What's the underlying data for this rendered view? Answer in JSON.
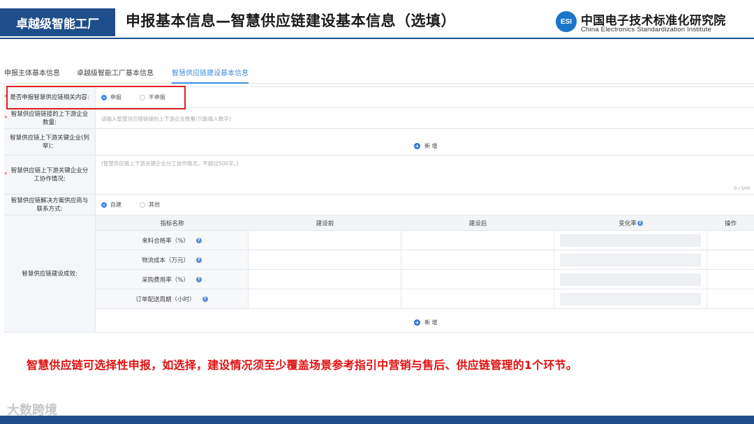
{
  "header": {
    "badge": "卓越级智能工厂",
    "title": "申报基本信息—智慧供应链建设基本信息（选填）",
    "logo_mark": "ESI",
    "logo_cn": "中国电子技术标准化研究院",
    "logo_en": "China Electronics Standardization Institute"
  },
  "tabs": [
    {
      "label": "申报主体基本信息"
    },
    {
      "label": "卓越级智能工厂基本信息"
    },
    {
      "label": "智慧供应链建设基本信息"
    }
  ],
  "form": {
    "declare": {
      "label": "是否申报智慧供应链相关内容:",
      "options": [
        "申报",
        "不申报"
      ]
    },
    "upstream_count": {
      "label": "智慧供应链链接的上下游企业数量:",
      "placeholder": "请输入智慧供应链链接的上下游企业数量(只能输入数字)"
    },
    "key_enterprises": {
      "label": "智慧供应链上下游关键企业(列举)：",
      "add_label": "新 增"
    },
    "division": {
      "label": "智慧供应链上下游关键企业分工协作情况:",
      "placeholder": "(智慧供应链上下游关键企业分工协作情况，不超过500字。)",
      "counter": "0 / 500"
    },
    "contact": {
      "label": "智慧供应链解决方案供应商与联系方式:",
      "options": [
        "自建",
        "其他"
      ]
    },
    "results": {
      "label": "智慧供应链建设成效:",
      "columns": [
        "指标名称",
        "建设前",
        "建设后",
        "变化率",
        "操作"
      ],
      "rows": [
        {
          "name": "来料合格率（%）"
        },
        {
          "name": "物流成本（万元）"
        },
        {
          "name": "采购费用率（%）"
        },
        {
          "name": "订单配送周期（小时）"
        }
      ],
      "add_label": "新 增"
    }
  },
  "note": "智慧供应链可选择性申报，如选择，建设情况须至少覆盖场景参考指引中营销与售后、供应链管理的1个环节。",
  "watermark": "大数跨境"
}
